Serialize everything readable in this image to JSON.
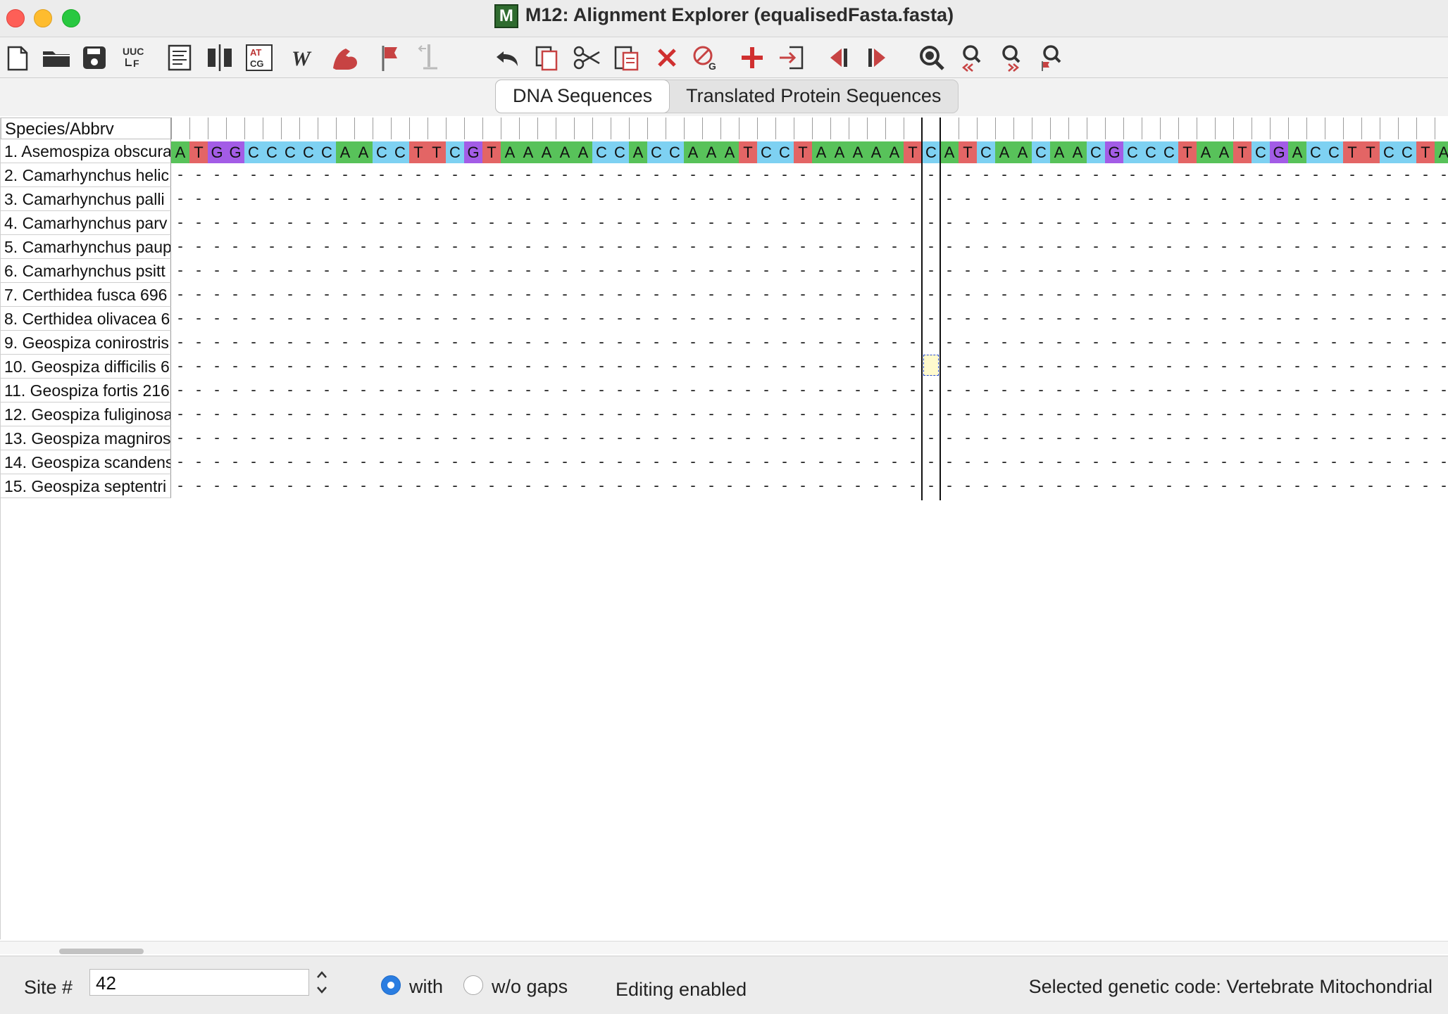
{
  "window": {
    "title": "M12: Alignment Explorer (equalisedFasta.fasta)",
    "app_icon_letter": "M"
  },
  "toolbar": {
    "buttons": [
      {
        "name": "new-file-icon",
        "label": ""
      },
      {
        "name": "open-folder-icon",
        "label": ""
      },
      {
        "name": "save-icon",
        "label": ""
      },
      {
        "name": "uuc-translate-icon",
        "label": "UUC"
      },
      {
        "name": "edit-lines-icon",
        "label": ""
      },
      {
        "name": "align-columns-icon",
        "label": ""
      },
      {
        "name": "atcg-icon",
        "label": "ATCG"
      },
      {
        "name": "web-w-icon",
        "label": "W"
      },
      {
        "name": "muscle-arm-icon",
        "label": ""
      },
      {
        "name": "flag-icon",
        "label": ""
      },
      {
        "name": "mark-site-icon",
        "label": ""
      },
      {
        "name": "undo-icon",
        "label": ""
      },
      {
        "name": "copy-icon",
        "label": ""
      },
      {
        "name": "cut-icon",
        "label": ""
      },
      {
        "name": "paste-icon",
        "label": ""
      },
      {
        "name": "delete-icon",
        "label": ""
      },
      {
        "name": "delete-gaps-icon",
        "label": ""
      },
      {
        "name": "insert-icon",
        "label": ""
      },
      {
        "name": "import-icon",
        "label": ""
      },
      {
        "name": "move-left-icon",
        "label": ""
      },
      {
        "name": "move-right-icon",
        "label": ""
      },
      {
        "name": "search-icon",
        "label": ""
      },
      {
        "name": "search-previous-icon",
        "label": ""
      },
      {
        "name": "search-next-icon",
        "label": ""
      },
      {
        "name": "search-marked-icon",
        "label": ""
      }
    ]
  },
  "tabs": [
    {
      "label": "DNA Sequences",
      "active": true
    },
    {
      "label": "Translated Protein Sequences",
      "active": false
    }
  ],
  "header_label": "Species/Abbrv",
  "species": [
    "1. Asemospiza obscura",
    "2. Camarhynchus helic",
    "3. Camarhynchus palli",
    "4. Camarhynchus parv",
    "5. Camarhynchus paup",
    "6. Camarhynchus psitt",
    "7. Certhidea fusca 696",
    "8. Certhidea olivacea 6",
    "9. Geospiza conirostris",
    "10. Geospiza difficilis 6",
    "11. Geospiza fortis 216",
    "12. Geospiza fuliginosa",
    "13. Geospiza magniros",
    "14. Geospiza scandens",
    "15. Geospiza septentri"
  ],
  "sequence1": "ATGGCCCCCAACCTTCGTAAAAACCACCAAATCCTAAAAATCATCAACAACGCCCTAATCGACCTTCCTA",
  "gap_char": "-",
  "base_colors": {
    "A": "#58c25a",
    "T": "#e36565",
    "G": "#a35ce6",
    "C": "#7ed1f2"
  },
  "selection": {
    "column": 42,
    "row": 10
  },
  "statusbar": {
    "site_label": "Site #",
    "site_value": "42",
    "with_label": "with",
    "without_label": "w/o gaps",
    "editing": "Editing enabled",
    "genetic_code": "Selected genetic code: Vertebrate Mitochondrial"
  }
}
